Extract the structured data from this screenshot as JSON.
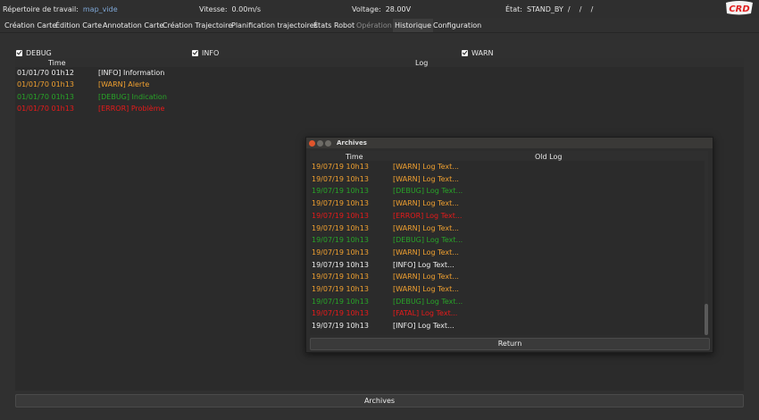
{
  "topbar": {
    "workdir_label": "Répertoire de travail:",
    "workdir_value": "map_vide",
    "speed_label": "Vitesse:",
    "speed_value": "0.00m/s",
    "voltage_label": "Voltage:",
    "voltage_value": "28.00V",
    "state_label": "État:",
    "state_value": "STAND_BY  /    /    /",
    "logo_text": "CRD",
    "logo_color": "#e02020"
  },
  "tabs": [
    {
      "label": "Création Carte",
      "state": "normal"
    },
    {
      "label": "Édition Carte",
      "state": "normal"
    },
    {
      "label": "Annotation Carte",
      "state": "normal"
    },
    {
      "label": "Création Trajectoire",
      "state": "normal"
    },
    {
      "label": "Planification trajectoires",
      "state": "normal"
    },
    {
      "label": "États Robot",
      "state": "normal"
    },
    {
      "label": "Opération",
      "state": "disabled"
    },
    {
      "label": "Historique",
      "state": "active"
    },
    {
      "label": "Configuration",
      "state": "normal"
    }
  ],
  "filters": {
    "debug": {
      "label": "DEBUG",
      "checked": true
    },
    "info": {
      "label": "INFO",
      "checked": true
    },
    "warn": {
      "label": "WARN",
      "checked": true
    }
  },
  "log_table": {
    "columns": [
      "Time",
      "Log"
    ],
    "rows": [
      {
        "time": "01/01/70 01h12",
        "message": "[INFO] Information",
        "level": "info"
      },
      {
        "time": "01/01/70 01h13",
        "message": "[WARN] Alerte",
        "level": "warn"
      },
      {
        "time": "01/01/70 01h13",
        "message": "[DEBUG] Indication",
        "level": "debug"
      },
      {
        "time": "01/01/70 01h13",
        "message": "[ERROR] Problème",
        "level": "error"
      }
    ]
  },
  "archives_button": "Archives",
  "archives_dialog": {
    "title": "Archives",
    "columns": [
      "Time",
      "Old Log"
    ],
    "rows": [
      {
        "time": "19/07/19 10h13",
        "message": "[WARN] Log Text...",
        "level": "warn"
      },
      {
        "time": "19/07/19 10h13",
        "message": "[WARN] Log Text...",
        "level": "warn"
      },
      {
        "time": "19/07/19 10h13",
        "message": "[DEBUG] Log Text...",
        "level": "debug"
      },
      {
        "time": "19/07/19 10h13",
        "message": "[WARN] Log Text...",
        "level": "warn"
      },
      {
        "time": "19/07/19 10h13",
        "message": "[ERROR] Log Text...",
        "level": "error"
      },
      {
        "time": "19/07/19 10h13",
        "message": "[WARN] Log Text...",
        "level": "warn"
      },
      {
        "time": "19/07/19 10h13",
        "message": "[DEBUG] Log Text...",
        "level": "debug"
      },
      {
        "time": "19/07/19 10h13",
        "message": "[WARN] Log Text...",
        "level": "warn"
      },
      {
        "time": "19/07/19 10h13",
        "message": "[INFO] Log Text...",
        "level": "info"
      },
      {
        "time": "19/07/19 10h13",
        "message": "[WARN] Log Text...",
        "level": "warn"
      },
      {
        "time": "19/07/19 10h13",
        "message": "[WARN] Log Text...",
        "level": "warn"
      },
      {
        "time": "19/07/19 10h13",
        "message": "[DEBUG] Log Text...",
        "level": "debug"
      },
      {
        "time": "19/07/19 10h13",
        "message": "[FATAL] Log Text...",
        "level": "fatal"
      },
      {
        "time": "19/07/19 10h13",
        "message": "[INFO] Log Text...",
        "level": "info"
      }
    ],
    "return_button": "Return"
  },
  "colors": {
    "info": "#ededed",
    "warn": "#f0a030",
    "debug": "#28a428",
    "error": "#e81a1a",
    "accent": "#6a9ad0"
  }
}
